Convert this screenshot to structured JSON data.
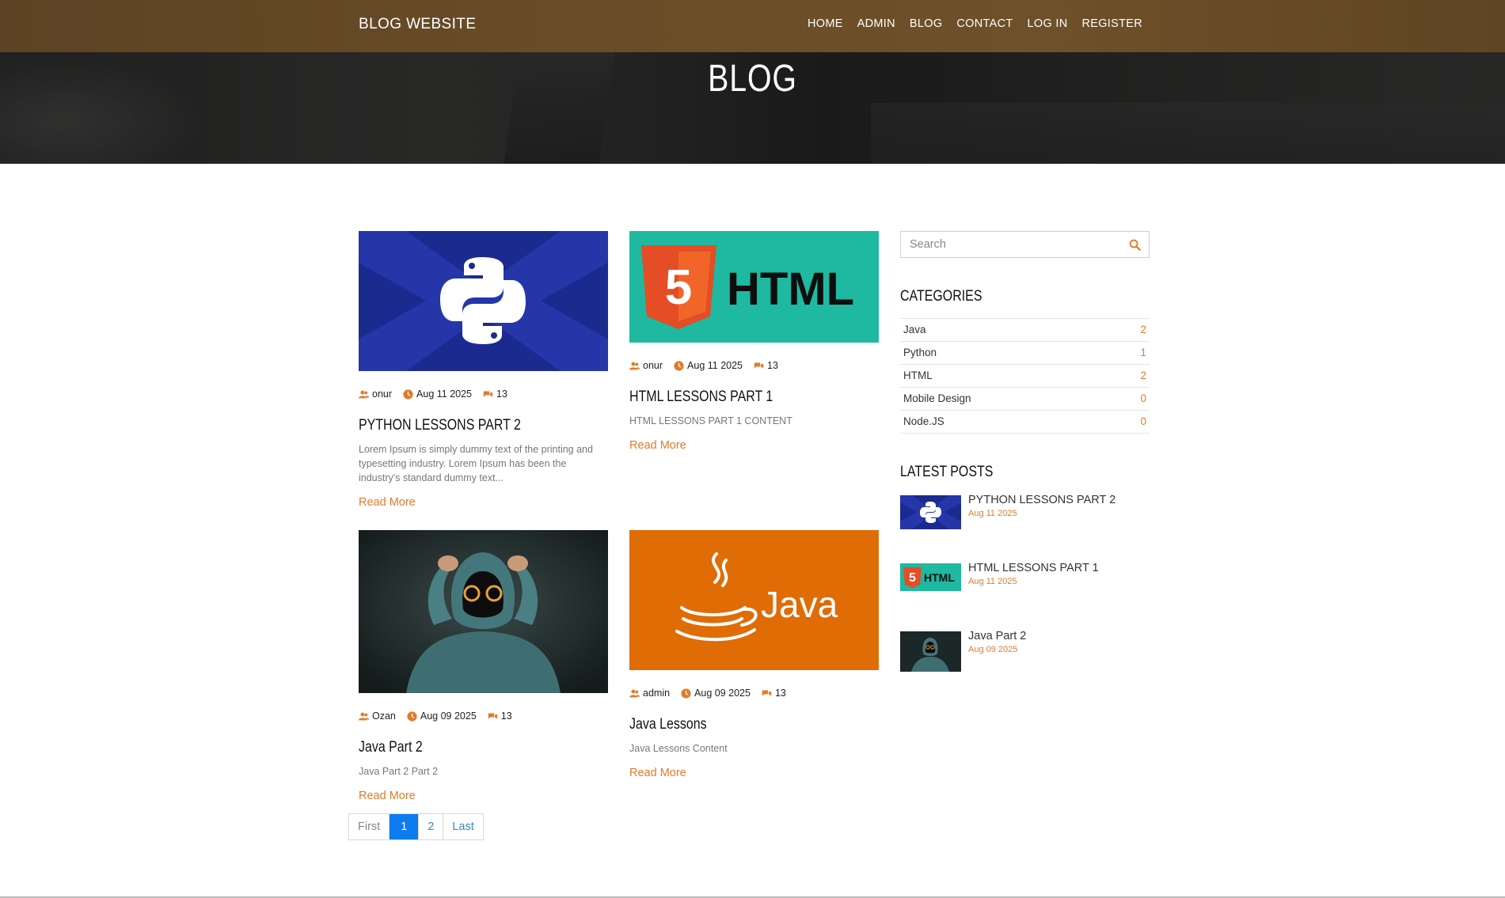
{
  "nav": {
    "brand": "BLOG WEBSITE",
    "links": [
      "HOME",
      "ADMIN",
      "BLOG",
      "CONTACT",
      "LOG IN",
      "REGISTER"
    ]
  },
  "hero": {
    "title": "BLOG"
  },
  "posts": [
    {
      "thumb_text": "python-logo",
      "author": "onur",
      "date": "Aug 11 2025",
      "comments": "13",
      "title": "PYTHON LESSONS PART 2",
      "excerpt": "Lorem Ipsum is simply dummy text of the printing and typesetting industry. Lorem Ipsum has been the industry's standard dummy text...",
      "read_more": "Read More"
    },
    {
      "thumb_text": "HTML",
      "badge": "5",
      "author": "onur",
      "date": "Aug 11 2025",
      "comments": "13",
      "title": "HTML LESSONS PART 1",
      "excerpt": "HTML LESSONS PART 1 CONTENT",
      "read_more": "Read More"
    },
    {
      "thumb_text": "hooded-figure",
      "author": "Ozan",
      "date": "Aug 09 2025",
      "comments": "13",
      "title": "Java Part 2",
      "excerpt": "Java Part 2 Part 2",
      "read_more": "Read More"
    },
    {
      "thumb_text": "Java",
      "author": "admin",
      "date": "Aug 09 2025",
      "comments": "13",
      "title": "Java Lessons",
      "excerpt": "Java Lessons Content",
      "read_more": "Read More"
    }
  ],
  "pagination": {
    "first": "First",
    "pages": [
      "1",
      "2"
    ],
    "last": "Last"
  },
  "sidebar": {
    "search_placeholder": "Search",
    "categories_title": "CATEGORIES",
    "categories": [
      {
        "name": "Java",
        "count": "2"
      },
      {
        "name": "Python",
        "count": "1"
      },
      {
        "name": "HTML",
        "count": "2"
      },
      {
        "name": "Mobile Design",
        "count": "0"
      },
      {
        "name": "Node.JS",
        "count": "0"
      }
    ],
    "latest_title": "LATEST POSTS",
    "latest": [
      {
        "title": "PYTHON LESSONS PART 2",
        "date": "Aug 11 2025"
      },
      {
        "title": "HTML LESSONS PART 1",
        "date": "Aug 11 2025"
      },
      {
        "title": "Java Part 2",
        "date": "Aug 09 2025"
      }
    ]
  },
  "colors": {
    "accent": "#e07b2a",
    "nav": "#6a4d28",
    "python_bg": "#1b2a8f",
    "html_bg": "#1eb9a0",
    "java_bg": "#e06c05",
    "active_page": "#0d7bf0"
  },
  "icons": {
    "author": "users-icon",
    "date": "clock-icon",
    "comments": "comments-icon",
    "search": "search-icon"
  }
}
